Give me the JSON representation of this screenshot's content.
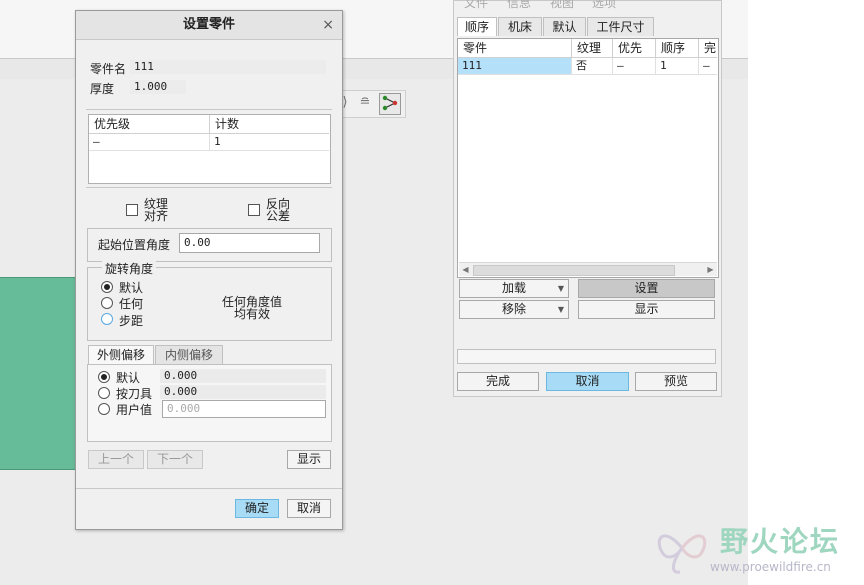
{
  "dialog": {
    "title": "设置零件",
    "close": "×",
    "part_name_label": "零件名",
    "part_name_value": "111",
    "thickness_label": "厚度",
    "thickness_value": "1.000",
    "grid": {
      "columns": [
        "优先级",
        "计数"
      ],
      "rows": [
        [
          "–",
          "1"
        ]
      ]
    },
    "texture_align": [
      "纹理",
      "对齐"
    ],
    "reverse_tolerance": [
      "反向",
      "公差"
    ],
    "start_angle_label": "起始位置角度",
    "start_angle_value": "0.00",
    "rotation_group": "旋转角度",
    "rotation_options": [
      "默认",
      "任何",
      "步距"
    ],
    "rotation_note": [
      "任何角度值",
      "均有效"
    ],
    "offset_tabs": [
      "外侧偏移",
      "内侧偏移"
    ],
    "offset_options": [
      "默认",
      "按刀具",
      "用户值"
    ],
    "offset_values": [
      "0.000",
      "0.000"
    ],
    "user_value_placeholder": "0.000",
    "prev_button": "上一个",
    "next_button": "下一个",
    "show_button": "显示",
    "ok_button": "确定",
    "cancel_button": "取消"
  },
  "panel": {
    "menu": [
      "文件",
      "信息",
      "视图",
      "选项"
    ],
    "tabs": [
      "顺序",
      "机床",
      "默认",
      "工件尺寸"
    ],
    "table": {
      "columns": [
        "零件",
        "纹理",
        "优先",
        "顺序",
        "完"
      ],
      "rows": [
        [
          "111",
          "否",
          "–",
          "1",
          "–"
        ]
      ]
    },
    "load_button": "加载",
    "remove_button": "移除",
    "setup_button": "设置",
    "display_button": "显示",
    "finish_button": "完成",
    "cancel_button": "取消",
    "preview_button": "预览"
  },
  "watermark": {
    "title": "野火论坛",
    "url": "www.proewildfire.cn"
  },
  "colors": {
    "accent_blue": "#a8dcf6",
    "selection": "#b4e0fa",
    "green_area": "#66bb99"
  }
}
